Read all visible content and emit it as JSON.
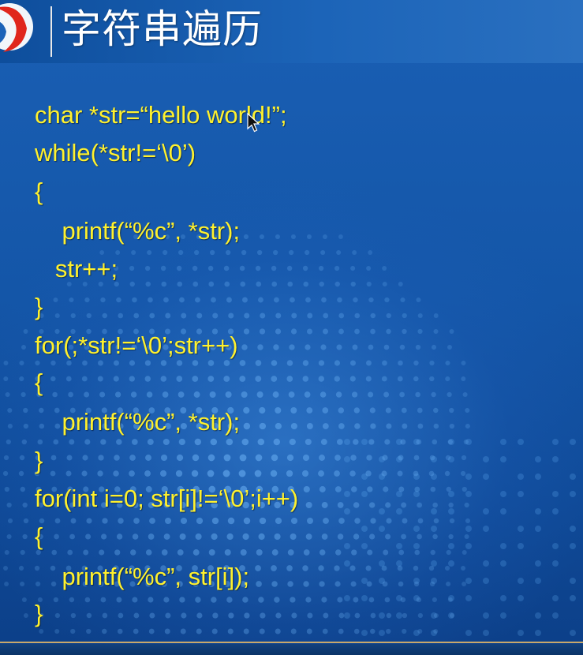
{
  "slide": {
    "title": "字符串遍历",
    "code_lines": [
      "char *str=“hello world!”;",
      "while(*str!=‘\\0’)",
      "{",
      "    printf(“%c”, *str);",
      "   str++;",
      "}",
      "for(;*str!=‘\\0’;str++)",
      "{",
      "    printf(“%c”, *str);",
      "}",
      "for(int i=0; str[i]!=‘\\0’;i++)",
      "{",
      "    printf(“%c”, str[i]);",
      "}"
    ]
  },
  "colors": {
    "background": "#1554a5",
    "code_text": "#fff12d",
    "title_text": "#ffffff",
    "logo_red": "#e0261c",
    "accent_line": "#c9a86a"
  },
  "icons": {
    "logo": "logo-icon",
    "cursor": "mouse-cursor-icon"
  }
}
